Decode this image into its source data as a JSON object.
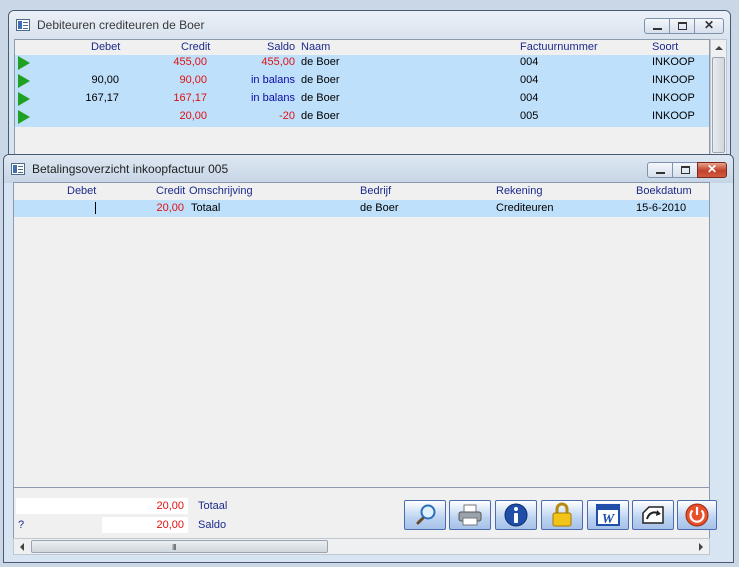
{
  "window1": {
    "title": "Debiteuren crediteuren de Boer",
    "columns": {
      "debet": "Debet",
      "credit": "Credit",
      "saldo": "Saldo",
      "naam": "Naam",
      "factuurnummer": "Factuurnummer",
      "soort": "Soort"
    },
    "rows": [
      {
        "debet": "",
        "credit": "455,00",
        "saldo": "455,00",
        "naam": "de Boer",
        "factuurnummer": "004",
        "soort": "INKOOP"
      },
      {
        "debet": "90,00",
        "credit": "90,00",
        "saldo": "in balans",
        "naam": "de Boer",
        "factuurnummer": "004",
        "soort": "INKOOP"
      },
      {
        "debet": "167,17",
        "credit": "167,17",
        "saldo": "in balans",
        "naam": "de Boer",
        "factuurnummer": "004",
        "soort": "INKOOP"
      },
      {
        "debet": "",
        "credit": "20,00",
        "saldo": "-20",
        "naam": "de Boer",
        "factuurnummer": "005",
        "soort": "INKOOP"
      }
    ]
  },
  "window2": {
    "title": "Betalingsoverzicht inkoopfactuur 005",
    "columns": {
      "debet": "Debet",
      "credit": "Credit",
      "omschrijving": "Omschrijving",
      "bedrijf": "Bedrijf",
      "rekening": "Rekening",
      "boekdatum": "Boekdatum"
    },
    "row": {
      "debet": "",
      "credit": "20,00",
      "omschrijving": "Totaal",
      "bedrijf": "de Boer",
      "rekening": "Crediteuren",
      "boekdatum": "15-6-2010"
    },
    "totals": {
      "totaal_value": "20,00",
      "totaal_label": "Totaal",
      "saldo_value": "20,00",
      "saldo_label": "Saldo",
      "question": "?"
    },
    "toolbar": [
      "magnifier-icon",
      "printer-icon",
      "info-icon",
      "lock-icon",
      "word-icon",
      "export-icon",
      "power-icon"
    ],
    "scroll_grip": "III"
  },
  "colors": {
    "row_highlight": "#bfe0fb",
    "negative_red": "#e01010",
    "header_blue": "#1b2a8c",
    "balance_blue": "#0a0aa8",
    "arrow_green": "#20a020"
  }
}
